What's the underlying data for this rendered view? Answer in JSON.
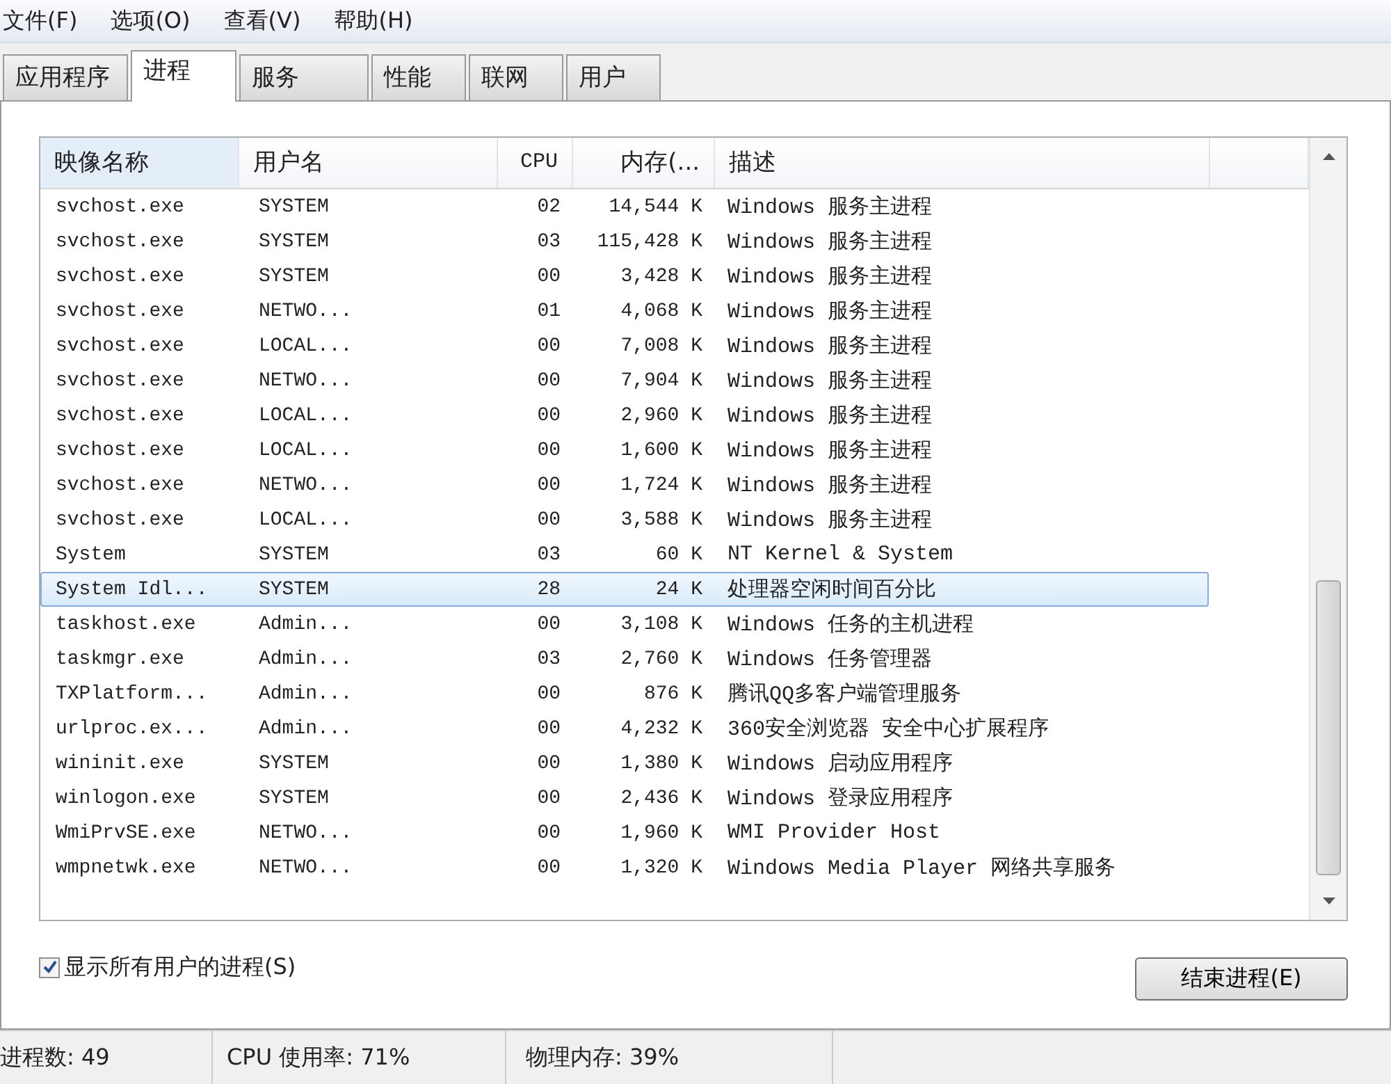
{
  "menu": [
    "文件(F)",
    "选项(O)",
    "查看(V)",
    "帮助(H)"
  ],
  "tabs": [
    {
      "label": "应用程序",
      "selected": false
    },
    {
      "label": "进程",
      "selected": true
    },
    {
      "label": "服务",
      "selected": false
    },
    {
      "label": "性能",
      "selected": false
    },
    {
      "label": "联网",
      "selected": false
    },
    {
      "label": "用户",
      "selected": false
    }
  ],
  "table": {
    "columns": [
      "映像名称",
      "用户名",
      "CPU",
      "内存(...",
      "描述"
    ],
    "rows": [
      {
        "cells": [
          "svchost.exe",
          "SYSTEM",
          "02",
          "14,544 K",
          "Windows 服务主进程"
        ],
        "selected": false
      },
      {
        "cells": [
          "svchost.exe",
          "SYSTEM",
          "03",
          "115,428 K",
          "Windows 服务主进程"
        ],
        "selected": false
      },
      {
        "cells": [
          "svchost.exe",
          "SYSTEM",
          "00",
          "3,428 K",
          "Windows 服务主进程"
        ],
        "selected": false
      },
      {
        "cells": [
          "svchost.exe",
          "NETWO...",
          "01",
          "4,068 K",
          "Windows 服务主进程"
        ],
        "selected": false
      },
      {
        "cells": [
          "svchost.exe",
          "LOCAL...",
          "00",
          "7,008 K",
          "Windows 服务主进程"
        ],
        "selected": false
      },
      {
        "cells": [
          "svchost.exe",
          "NETWO...",
          "00",
          "7,904 K",
          "Windows 服务主进程"
        ],
        "selected": false
      },
      {
        "cells": [
          "svchost.exe",
          "LOCAL...",
          "00",
          "2,960 K",
          "Windows 服务主进程"
        ],
        "selected": false
      },
      {
        "cells": [
          "svchost.exe",
          "LOCAL...",
          "00",
          "1,600 K",
          "Windows 服务主进程"
        ],
        "selected": false
      },
      {
        "cells": [
          "svchost.exe",
          "NETWO...",
          "00",
          "1,724 K",
          "Windows 服务主进程"
        ],
        "selected": false
      },
      {
        "cells": [
          "svchost.exe",
          "LOCAL...",
          "00",
          "3,588 K",
          "Windows 服务主进程"
        ],
        "selected": false
      },
      {
        "cells": [
          "System",
          "SYSTEM",
          "03",
          "60 K",
          "NT Kernel & System"
        ],
        "selected": false
      },
      {
        "cells": [
          "System Idl...",
          "SYSTEM",
          "28",
          "24 K",
          "处理器空闲时间百分比"
        ],
        "selected": true
      },
      {
        "cells": [
          "taskhost.exe",
          "Admin...",
          "00",
          "3,108 K",
          "Windows 任务的主机进程"
        ],
        "selected": false
      },
      {
        "cells": [
          "taskmgr.exe",
          "Admin...",
          "03",
          "2,760 K",
          "Windows 任务管理器"
        ],
        "selected": false
      },
      {
        "cells": [
          "TXPlatform...",
          "Admin...",
          "00",
          "876 K",
          "腾讯QQ多客户端管理服务"
        ],
        "selected": false
      },
      {
        "cells": [
          "urlproc.ex...",
          "Admin...",
          "00",
          "4,232 K",
          "360安全浏览器 安全中心扩展程序"
        ],
        "selected": false
      },
      {
        "cells": [
          "wininit.exe",
          "SYSTEM",
          "00",
          "1,380 K",
          "Windows 启动应用程序"
        ],
        "selected": false
      },
      {
        "cells": [
          "winlogon.exe",
          "SYSTEM",
          "00",
          "2,436 K",
          "Windows 登录应用程序"
        ],
        "selected": false
      },
      {
        "cells": [
          "WmiPrvSE.exe",
          "NETWO...",
          "00",
          "1,960 K",
          "WMI Provider Host"
        ],
        "selected": false
      },
      {
        "cells": [
          "wmpnetwk.exe",
          "NETWO...",
          "00",
          "1,320 K",
          "Windows Media Player 网络共享服务"
        ],
        "selected": false
      }
    ]
  },
  "show_all_users": {
    "label": "显示所有用户的进程(S)",
    "checked": true
  },
  "end_button": "结束进程(E)",
  "status_bar": [
    "进程数: 49",
    "CPU 使用率: 71%",
    "物理内存: 39%"
  ]
}
